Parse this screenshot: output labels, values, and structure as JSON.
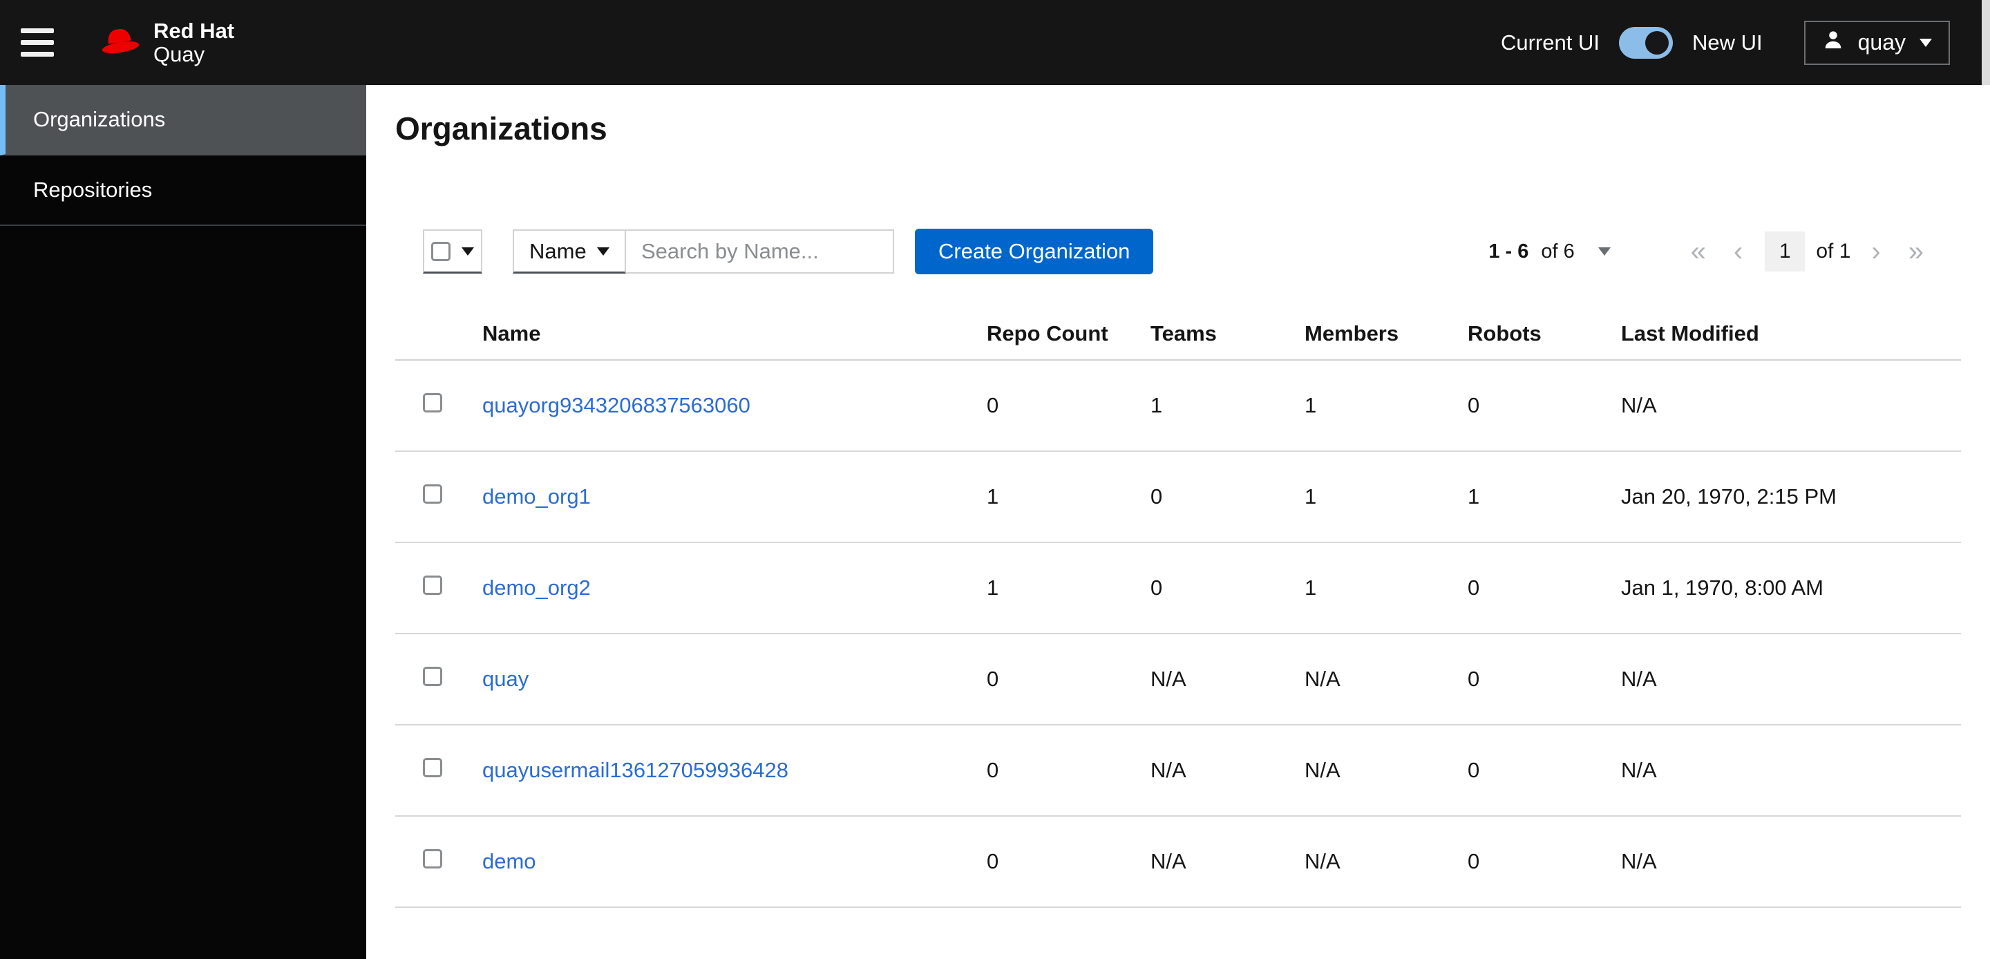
{
  "masthead": {
    "brand": {
      "line1": "Red Hat",
      "line2": "Quay"
    },
    "ui_toggle": {
      "left_label": "Current UI",
      "right_label": "New UI",
      "checked": true
    },
    "user_menu": {
      "username": "quay"
    }
  },
  "sidebar": {
    "items": [
      {
        "label": "Organizations",
        "active": true
      },
      {
        "label": "Repositories",
        "active": false
      }
    ]
  },
  "page": {
    "title": "Organizations"
  },
  "toolbar": {
    "filter_field": {
      "selected": "Name"
    },
    "search": {
      "placeholder": "Search by Name..."
    },
    "create_button_label": "Create Organization"
  },
  "pagination": {
    "range_bold": "1 - 6",
    "range_rest": "of 6",
    "current_page": "1",
    "of_pages": "of 1"
  },
  "icons": {
    "hamburger": "three-bars",
    "redhat_logo": "red-fedora",
    "user": "person-silhouette",
    "dropdown_caret": "▾",
    "first_page": "«",
    "prev_page": "‹",
    "next_page": "›",
    "last_page": "»"
  },
  "table": {
    "columns": [
      "Name",
      "Repo Count",
      "Teams",
      "Members",
      "Robots",
      "Last Modified"
    ],
    "rows": [
      {
        "name": "quayorg9343206837563060",
        "repo_count": "0",
        "teams": "1",
        "members": "1",
        "robots": "0",
        "last_modified": "N/A"
      },
      {
        "name": "demo_org1",
        "repo_count": "1",
        "teams": "0",
        "members": "1",
        "robots": "1",
        "last_modified": "Jan 20, 1970, 2:15 PM"
      },
      {
        "name": "demo_org2",
        "repo_count": "1",
        "teams": "0",
        "members": "1",
        "robots": "0",
        "last_modified": "Jan 1, 1970, 8:00 AM"
      },
      {
        "name": "quay",
        "repo_count": "0",
        "teams": "N/A",
        "members": "N/A",
        "robots": "0",
        "last_modified": "N/A"
      },
      {
        "name": "quayusermail136127059936428",
        "repo_count": "0",
        "teams": "N/A",
        "members": "N/A",
        "robots": "0",
        "last_modified": "N/A"
      },
      {
        "name": "demo",
        "repo_count": "0",
        "teams": "N/A",
        "members": "N/A",
        "robots": "0",
        "last_modified": "N/A"
      }
    ]
  },
  "colors": {
    "masthead_bg": "#151515",
    "sidebar_bg": "#060606",
    "nav_active_bg": "#4f5255",
    "nav_active_accent": "#73bcf7",
    "primary_button": "#0066cc",
    "link": "#2b6cd4",
    "toggle_on": "#8bbde8"
  }
}
